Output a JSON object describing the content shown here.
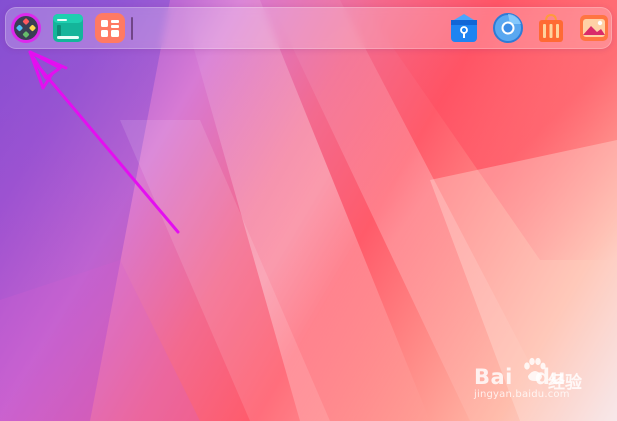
{
  "screen": {
    "type": "desktop"
  },
  "dock": {
    "left_icons": [
      {
        "name": "launcher-icon",
        "label": ""
      },
      {
        "name": "system-monitor-icon",
        "label": ""
      },
      {
        "name": "app-grid-icon",
        "label": ""
      }
    ],
    "right_icons": [
      {
        "name": "app-store-icon",
        "label": ""
      },
      {
        "name": "browser-icon",
        "label": ""
      },
      {
        "name": "shopping-bag-icon",
        "label": ""
      },
      {
        "name": "photo-viewer-icon",
        "label": ""
      }
    ]
  },
  "colors": {
    "annotation_arrow": "#e40ff0",
    "launcher_ring": "#e81cf0",
    "system_monitor": "#14b59a",
    "app_grid": "#ff7a63",
    "app_store": "#1e84f2",
    "browser": "#3c8de6",
    "shopping_bag": "#ff6a34",
    "photo_viewer": "#ff7542"
  },
  "watermark": {
    "brand": "Bai",
    "brand_suffix": "du",
    "cn": "经验",
    "url": "jingyan.baidu.com"
  }
}
